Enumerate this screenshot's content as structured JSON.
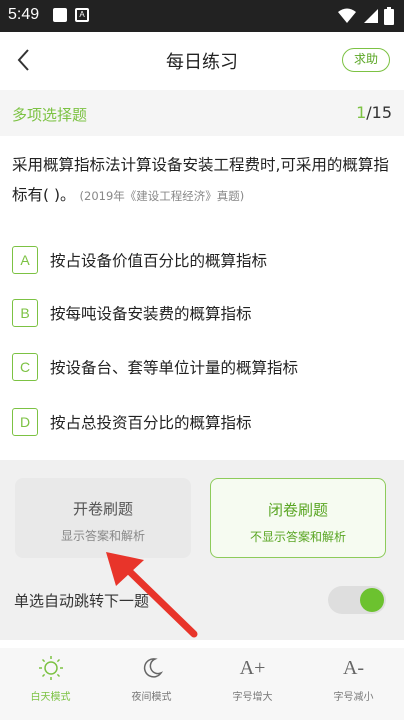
{
  "statusbar": {
    "time": "5:49",
    "notif_letter": "A"
  },
  "header": {
    "title": "每日练习",
    "help_label": "求助"
  },
  "question_bar": {
    "type": "多项选择题",
    "current": "1",
    "total": "/15"
  },
  "question": {
    "text": "采用概算指标法计算设备安装工程费时,可采用的概算指标有( )。",
    "source": "(2019年《建设工程经济》真题)"
  },
  "options": [
    {
      "letter": "A",
      "text": "按占设备价值百分比的概算指标"
    },
    {
      "letter": "B",
      "text": "按每吨设备安装费的概算指标"
    },
    {
      "letter": "C",
      "text": "按设备台、套等单位计量的概算指标"
    },
    {
      "letter": "D",
      "text": "按占总投资百分比的概算指标"
    }
  ],
  "modes": {
    "open": {
      "title": "开卷刷题",
      "subtitle": "显示答案和解析"
    },
    "closed": {
      "title": "闭卷刷题",
      "subtitle": "不显示答案和解析"
    }
  },
  "auto_next": {
    "label": "单选自动跳转下一题",
    "enabled": true
  },
  "toolbar": [
    {
      "icon": "sun-icon",
      "label": "白天模式",
      "active": true
    },
    {
      "icon": "moon-icon",
      "label": "夜间模式",
      "active": false
    },
    {
      "icon": "font-increase-icon",
      "glyph": "A+",
      "label": "字号增大",
      "active": false
    },
    {
      "icon": "font-decrease-icon",
      "glyph": "A-",
      "label": "字号减小",
      "active": false
    }
  ],
  "colors": {
    "accent": "#7cc243",
    "arrow": "#e8342a"
  }
}
